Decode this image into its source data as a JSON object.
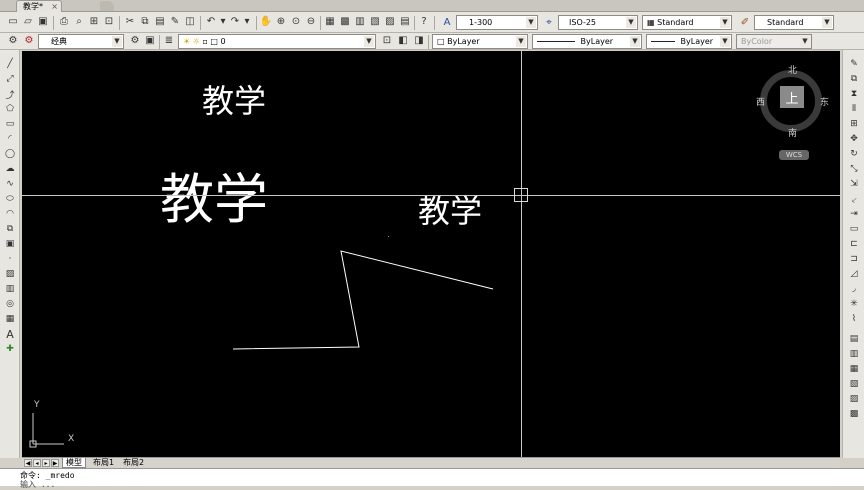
{
  "window": {
    "doc_tab": "教学*",
    "tab_close": "×"
  },
  "toolbar": {
    "text_scale_value": "1-300",
    "dim_style_value": "ISO-25",
    "text_style_value": "Standard",
    "table_style_value": "Standard",
    "workspace_value": "经典",
    "layer_value": "0",
    "color_value": "ByLayer",
    "linetype_value": "ByLayer",
    "lineweight_value": "ByLayer",
    "plotstyle_value": "ByColor"
  },
  "canvas": {
    "text_small": "教学",
    "text_large": "教学",
    "text_medium": "教学"
  },
  "viewcube": {
    "north": "北",
    "south": "南",
    "east": "东",
    "west": "西",
    "face": "上",
    "wcs": "WCS"
  },
  "ucs": {
    "y_label": "Y",
    "x_label": "X"
  },
  "layout_tabs": [
    "模型",
    "布局1",
    "布局2"
  ],
  "command": {
    "line1": "命令: _mredo",
    "line2": "输入 ..."
  },
  "colors": {
    "canvas_bg": "#000000",
    "entity": "#ffffff",
    "crosshair": "#c8c8c8"
  }
}
